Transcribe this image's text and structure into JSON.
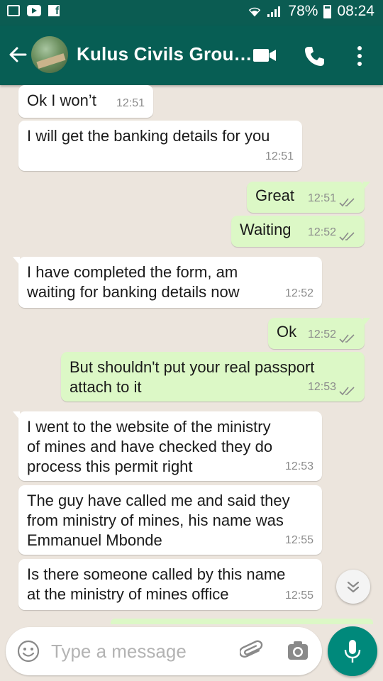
{
  "status_bar": {
    "battery": "78%",
    "time": "08:24"
  },
  "header": {
    "title": "Kulus Civils Grou…"
  },
  "messages": [
    {
      "dir": "in",
      "text": "Ok I won’t",
      "time": "12:51"
    },
    {
      "dir": "in",
      "text": "I will get the banking details for you",
      "time": "12:51"
    },
    {
      "dir": "out",
      "text": "Great",
      "time": "12:51",
      "status": "read"
    },
    {
      "dir": "out",
      "text": "Waiting",
      "time": "12:52",
      "status": "read"
    },
    {
      "dir": "in",
      "text": "I have completed the form, am\nwaiting for banking details now",
      "time": "12:52"
    },
    {
      "dir": "out",
      "text": "Ok",
      "time": "12:52",
      "status": "read"
    },
    {
      "dir": "out",
      "text": "But shouldn't put your real passport\nattach to it",
      "time": "12:53",
      "status": "read"
    },
    {
      "dir": "in",
      "text": "I went to the website of the ministry\nof mines and have checked they do\nprocess this permit right",
      "time": "12:53"
    },
    {
      "dir": "in",
      "text": "The guy have called me and said they\nfrom ministry of mines, his name was\nEmmanuel Mbonde",
      "time": "12:55"
    },
    {
      "dir": "in",
      "text": "Is there someone called by this name\nat the ministry of mines office",
      "time": "12:55"
    }
  ],
  "composer": {
    "placeholder": "Type a message"
  },
  "icons": {
    "back": "arrow-left-icon",
    "video": "video-call-icon",
    "call": "phone-icon",
    "menu": "more-vertical-icon",
    "emoji": "emoji-icon",
    "attach": "paperclip-icon",
    "camera": "camera-icon",
    "mic": "microphone-icon",
    "scroll": "chevron-double-down-icon"
  },
  "colors": {
    "header": "#075e54",
    "status_bar": "#0b5c52",
    "outgoing_bubble": "#dcf8c6",
    "incoming_bubble": "#ffffff",
    "chat_background": "#ece5dd",
    "mic_button": "#00897b",
    "read_ticks": "#8b8b8b"
  }
}
